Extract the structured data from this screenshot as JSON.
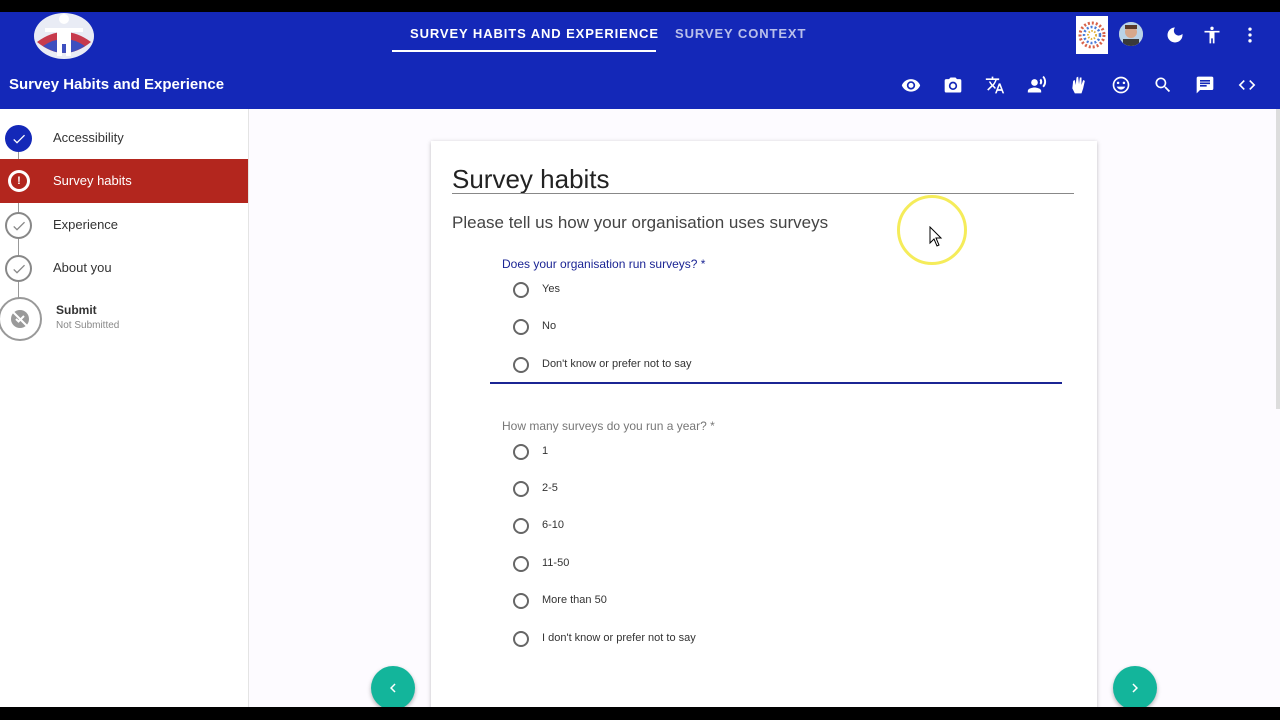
{
  "header": {
    "tabs": [
      {
        "label": "Survey Habits and Experience",
        "active": true
      },
      {
        "label": "Survey Context",
        "active": false
      }
    ],
    "title": "Survey Habits and Experience",
    "top_icons": [
      "org-logo",
      "user-avatar",
      "dark-mode-icon",
      "accessibility-icon",
      "more-vert-icon"
    ],
    "toolbar_icons": [
      "eye-icon",
      "camera-icon",
      "translate-icon",
      "record-voice-icon",
      "sign-language-icon",
      "emoji-icon",
      "zoom-icon",
      "comment-icon",
      "code-icon"
    ]
  },
  "sidebar": {
    "steps": [
      {
        "label": "Accessibility",
        "state": "completed"
      },
      {
        "label": "Survey habits",
        "state": "error"
      },
      {
        "label": "Experience",
        "state": "pending"
      },
      {
        "label": "About you",
        "state": "pending"
      },
      {
        "label": "Submit",
        "sublabel": "Not Submitted",
        "state": "not-submitted"
      }
    ]
  },
  "card": {
    "title": "Survey habits",
    "subtitle": "Please tell us how your organisation uses surveys",
    "questions": [
      {
        "label": "Does your organisation run surveys? *",
        "focused": true,
        "options": [
          "Yes",
          "No",
          "Don't know or prefer not to say"
        ]
      },
      {
        "label": "How many surveys do you run a year? *",
        "focused": false,
        "options": [
          "1",
          "2-5",
          "6-10",
          "11-50",
          "More than 50",
          "I don't know or prefer not to say"
        ]
      }
    ]
  },
  "nav": {
    "prev_icon": "chevron-left-icon",
    "next_icon": "chevron-right-icon"
  },
  "colors": {
    "primary": "#1428b8",
    "error": "#b3261e",
    "accent": "#13b59b",
    "question_focused": "#1b2594"
  }
}
